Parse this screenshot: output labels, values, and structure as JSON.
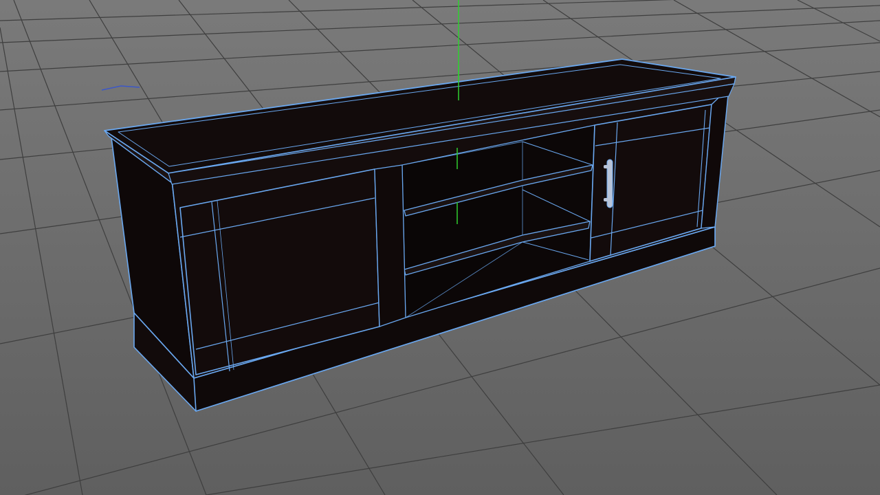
{
  "viewport": {
    "background_color_top": "#7a7a7a",
    "background_color_bottom": "#5f5f5f",
    "grid_color": "#3e3e3e",
    "grid_visible": true,
    "y_axis_color": "#2fcf2f",
    "axis_indicator_color": "#3b57c9"
  },
  "model": {
    "selected": true,
    "wireframe_overlay": true,
    "wire_color": "#6aa8f0",
    "body_color": "#120b0b",
    "shelf_color": "#1a1212",
    "handle_color": "#b8c4d8",
    "handle_icon": "bar-handle-icon"
  }
}
